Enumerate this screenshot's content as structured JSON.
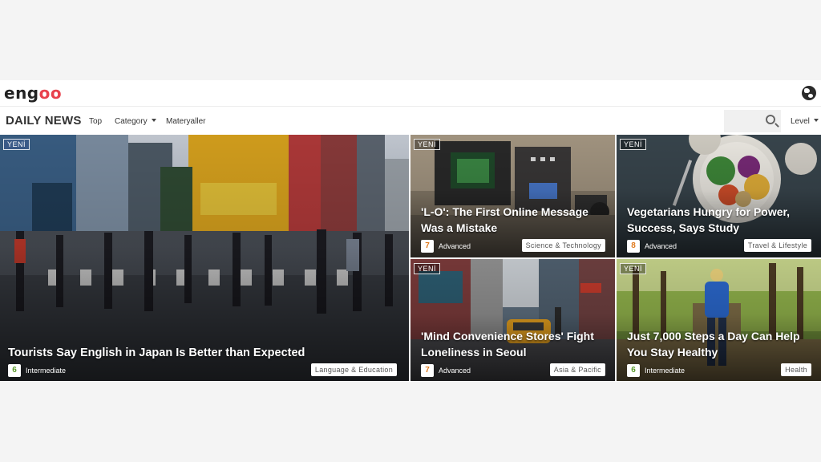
{
  "brand": {
    "logo_prefix": "eng",
    "logo_suffix": "oo"
  },
  "nav": {
    "title": "DAILY NEWS",
    "items": [
      {
        "label": "Top"
      },
      {
        "label": "Category"
      },
      {
        "label": "Materyaller"
      }
    ],
    "search_icon": "search-icon",
    "level_label": "Level",
    "globe_icon": "globe-icon"
  },
  "articles": [
    {
      "badge": "YENİ",
      "title": "Tourists Say English in Japan Is Better than Expected",
      "level_num": "6",
      "level_label": "Intermediate",
      "category": "Language & Education"
    },
    {
      "badge": "YENİ",
      "title": "'L-O': The First Online Message Was a Mistake",
      "level_num": "7",
      "level_label": "Advanced",
      "category": "Science & Technology"
    },
    {
      "badge": "YENİ",
      "title": "Vegetarians Hungry for Power, Success, Says Study",
      "level_num": "8",
      "level_label": "Advanced",
      "category": "Travel & Lifestyle"
    },
    {
      "badge": "YENİ",
      "title": "'Mind Convenience Stores' Fight Loneliness in Seoul",
      "level_num": "7",
      "level_label": "Advanced",
      "category": "Asia & Pacific"
    },
    {
      "badge": "YENİ",
      "title": "Just 7,000 Steps a Day Can Help You Stay Healthy",
      "level_num": "6",
      "level_label": "Intermediate",
      "category": "Health"
    }
  ],
  "colors": {
    "logo_accent": "#e8424d",
    "intermediate": "#5a9a2a",
    "advanced": "#e07b1f"
  }
}
